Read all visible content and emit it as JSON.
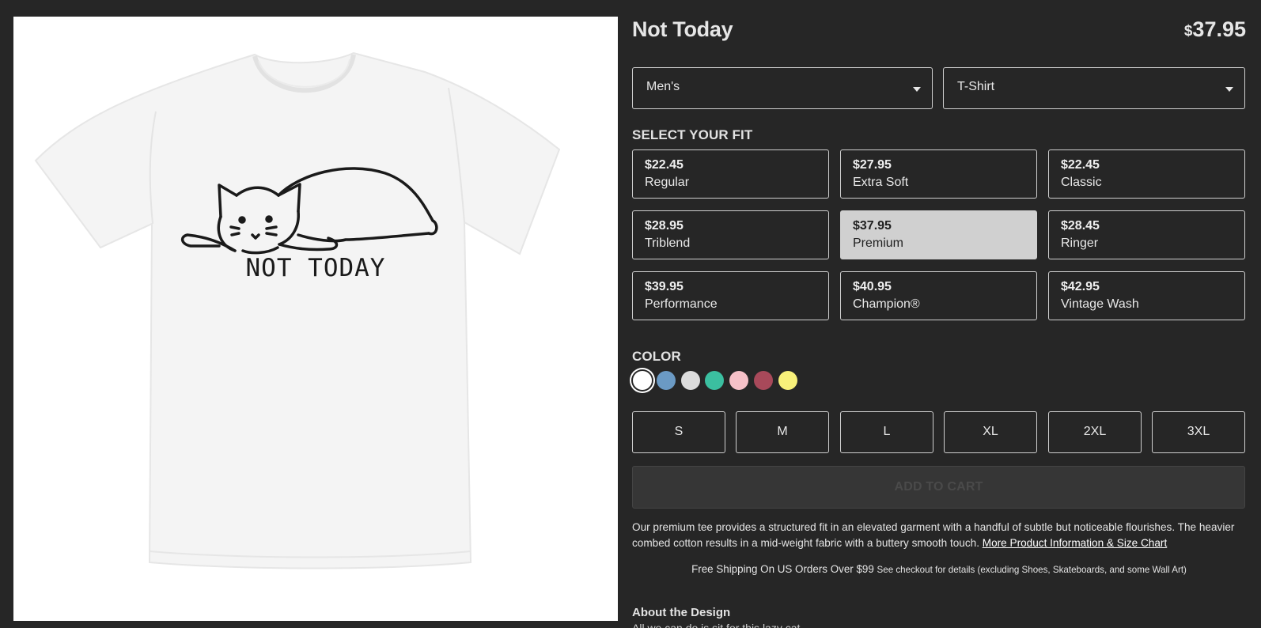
{
  "product": {
    "title": "Not Today",
    "price_symbol": "$",
    "price_amount": "37.95",
    "image_text": "NOT TODAY"
  },
  "selectors": {
    "gender": "Men's",
    "type": "T-Shirt"
  },
  "fit_section_label": "SELECT YOUR FIT",
  "fits": [
    {
      "price": "$22.45",
      "name": "Regular",
      "selected": false
    },
    {
      "price": "$27.95",
      "name": "Extra Soft",
      "selected": false
    },
    {
      "price": "$22.45",
      "name": "Classic",
      "selected": false
    },
    {
      "price": "$28.95",
      "name": "Triblend",
      "selected": false
    },
    {
      "price": "$37.95",
      "name": "Premium",
      "selected": true
    },
    {
      "price": "$28.45",
      "name": "Ringer",
      "selected": false
    },
    {
      "price": "$39.95",
      "name": "Performance",
      "selected": false
    },
    {
      "price": "$40.95",
      "name": "Champion®",
      "selected": false
    },
    {
      "price": "$42.95",
      "name": "Vintage Wash",
      "selected": false
    }
  ],
  "color_section_label": "COLOR",
  "colors": [
    "#ffffff",
    "#6b9ac4",
    "#dcdcdc",
    "#3bbfa0",
    "#f6c1c8",
    "#a8495a",
    "#f8f17a"
  ],
  "selected_color": "#ffffff",
  "sizes": [
    "S",
    "M",
    "L",
    "XL",
    "2XL",
    "3XL"
  ],
  "add_to_cart_label": "ADD TO CART",
  "description": {
    "text": "Our premium tee provides a structured fit in an elevated garment with a handful of subtle but noticeable flourishes. The heavier combed cotton results in a mid-weight fabric with a buttery smooth touch.",
    "link": "More Product Information & Size Chart"
  },
  "shipping": {
    "main": "Free Shipping On US Orders Over $99",
    "fine": "See checkout for details (excluding Shoes, Skateboards, and some Wall Art)"
  },
  "about": {
    "title": "About the Design",
    "subtitle": "All we can do is sit for this lazy cat."
  }
}
